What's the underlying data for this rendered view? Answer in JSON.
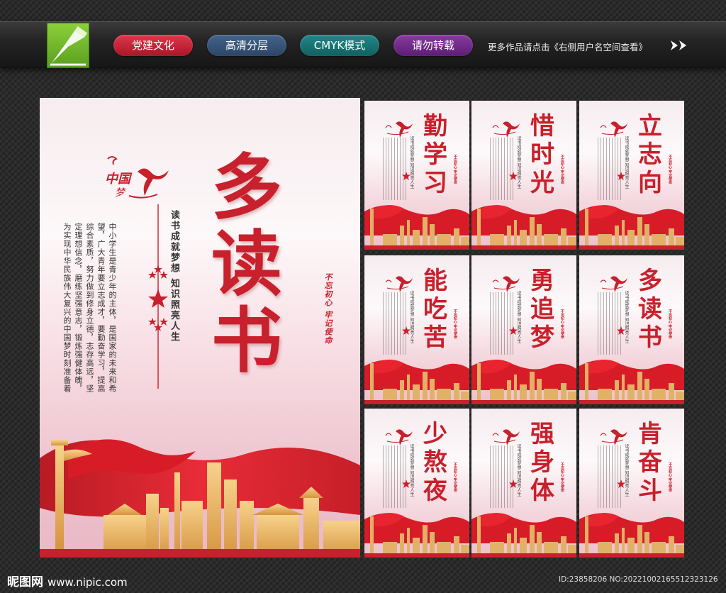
{
  "header": {
    "tags": [
      "党建文化",
      "高清分层",
      "CMYK模式",
      "请勿转载"
    ],
    "more_text": "更多作品请点击《右侧用户名空间查看》",
    "colors": {
      "tag1": "#c8202c",
      "tag2": "#34557a",
      "tag3": "#177575",
      "tag4": "#6e2a88"
    }
  },
  "main_poster": {
    "title": [
      "多",
      "读",
      "书"
    ],
    "subtitle": "读书成就梦想  知识照亮人生",
    "body": "中小学生是青少年的主体，是国家的未来和希望，广大青年要立志成才，要勤奋学习，提高综合素质，努力做到修身立德，志存高远，坚定理想信念，磨练坚强意志，锻炼强健体魄，为实现中华民族伟大复兴的中国梦时刻准备着",
    "seal": "不忘初心  牢记使命",
    "logo_text": "中国梦",
    "accent_color": "#c8202c"
  },
  "small_posters": [
    {
      "title": [
        "勤",
        "学",
        "习"
      ]
    },
    {
      "title": [
        "惜",
        "时",
        "光"
      ]
    },
    {
      "title": [
        "立",
        "志",
        "向"
      ]
    },
    {
      "title": [
        "能",
        "吃",
        "苦"
      ]
    },
    {
      "title": [
        "勇",
        "追",
        "梦"
      ]
    },
    {
      "title": [
        "多",
        "读",
        "书"
      ]
    },
    {
      "title": [
        "少",
        "熬",
        "夜"
      ]
    },
    {
      "title": [
        "强",
        "身",
        "体"
      ]
    },
    {
      "title": [
        "肯",
        "奋",
        "斗"
      ]
    }
  ],
  "small_poster_common": {
    "subtitle": "读书成就梦想  知识照亮人生",
    "seal": "不忘初心 牢记使命"
  },
  "footer": {
    "site_name": "昵图网",
    "url": "www.nipic.com",
    "id_text": "ID:23858206 NO:20221002165512323126"
  }
}
